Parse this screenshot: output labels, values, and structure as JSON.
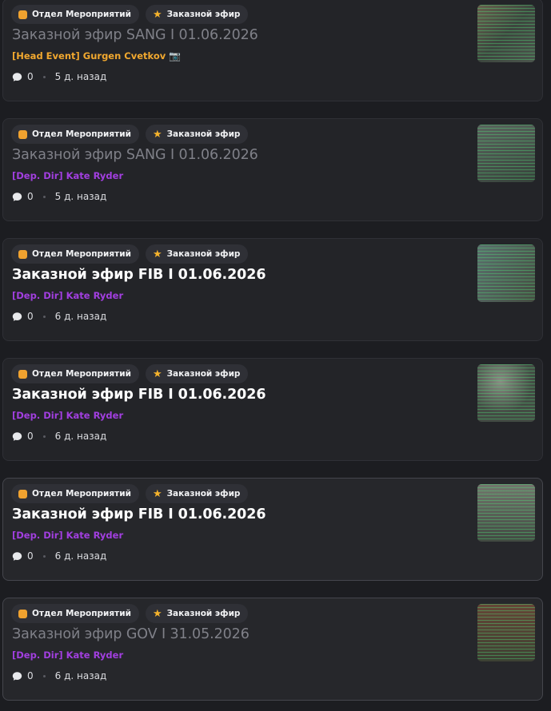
{
  "posts": [
    {
      "tag_department": "Отдел Мероприятий",
      "tag_type": "Заказной эфир",
      "title": "Заказной эфир SANG I 01.06.2026",
      "author": "[Head Event] Gurgen Cvetkov",
      "author_emoji": "📷",
      "author_color": "#f1a82f",
      "comments": "0",
      "time": "5 д. назад",
      "read": true,
      "thumbnail_icon": "screenshot-thumbnail"
    },
    {
      "tag_department": "Отдел Мероприятий",
      "tag_type": "Заказной эфир",
      "title": "Заказной эфир SANG I 01.06.2026",
      "author": "[Dep. Dir] Kate Ryder",
      "author_color": "#a23fe0",
      "comments": "0",
      "time": "5 д. назад",
      "read": true,
      "thumbnail_icon": "screenshot-thumbnail"
    },
    {
      "tag_department": "Отдел Мероприятий",
      "tag_type": "Заказной эфир",
      "title": "Заказной эфир FIB I 01.06.2026",
      "author": "[Dep. Dir] Kate Ryder",
      "author_color": "#a23fe0",
      "comments": "0",
      "time": "6 д. назад",
      "read": false,
      "thumbnail_icon": "screenshot-thumbnail"
    },
    {
      "tag_department": "Отдел Мероприятий",
      "tag_type": "Заказной эфир",
      "title": "Заказной эфир FIB I 01.06.2026",
      "author": "[Dep. Dir] Kate Ryder",
      "author_color": "#a23fe0",
      "comments": "0",
      "time": "6 д. назад",
      "read": false,
      "thumbnail_icon": "screenshot-thumbnail"
    },
    {
      "tag_department": "Отдел Мероприятий",
      "tag_type": "Заказной эфир",
      "title": "Заказной эфир FIB I 01.06.2026",
      "author": "[Dep. Dir] Kate Ryder",
      "author_color": "#a23fe0",
      "comments": "0",
      "time": "6 д. назад",
      "read": false,
      "thumbnail_icon": "screenshot-thumbnail"
    },
    {
      "tag_department": "Отдел Мероприятий",
      "tag_type": "Заказной эфир",
      "title": "Заказной эфир GOV I 31.05.2026",
      "author": "[Dep. Dir] Kate Ryder",
      "author_color": "#a23fe0",
      "comments": "0",
      "time": "6 д. назад",
      "read": true,
      "thumbnail_icon": "screenshot-thumbnail"
    }
  ],
  "colors": {
    "background": "#1c1d21",
    "card": "#232428",
    "tag_department_icon": "#f0a22f",
    "tag_star_icon": "#f5b32c"
  }
}
